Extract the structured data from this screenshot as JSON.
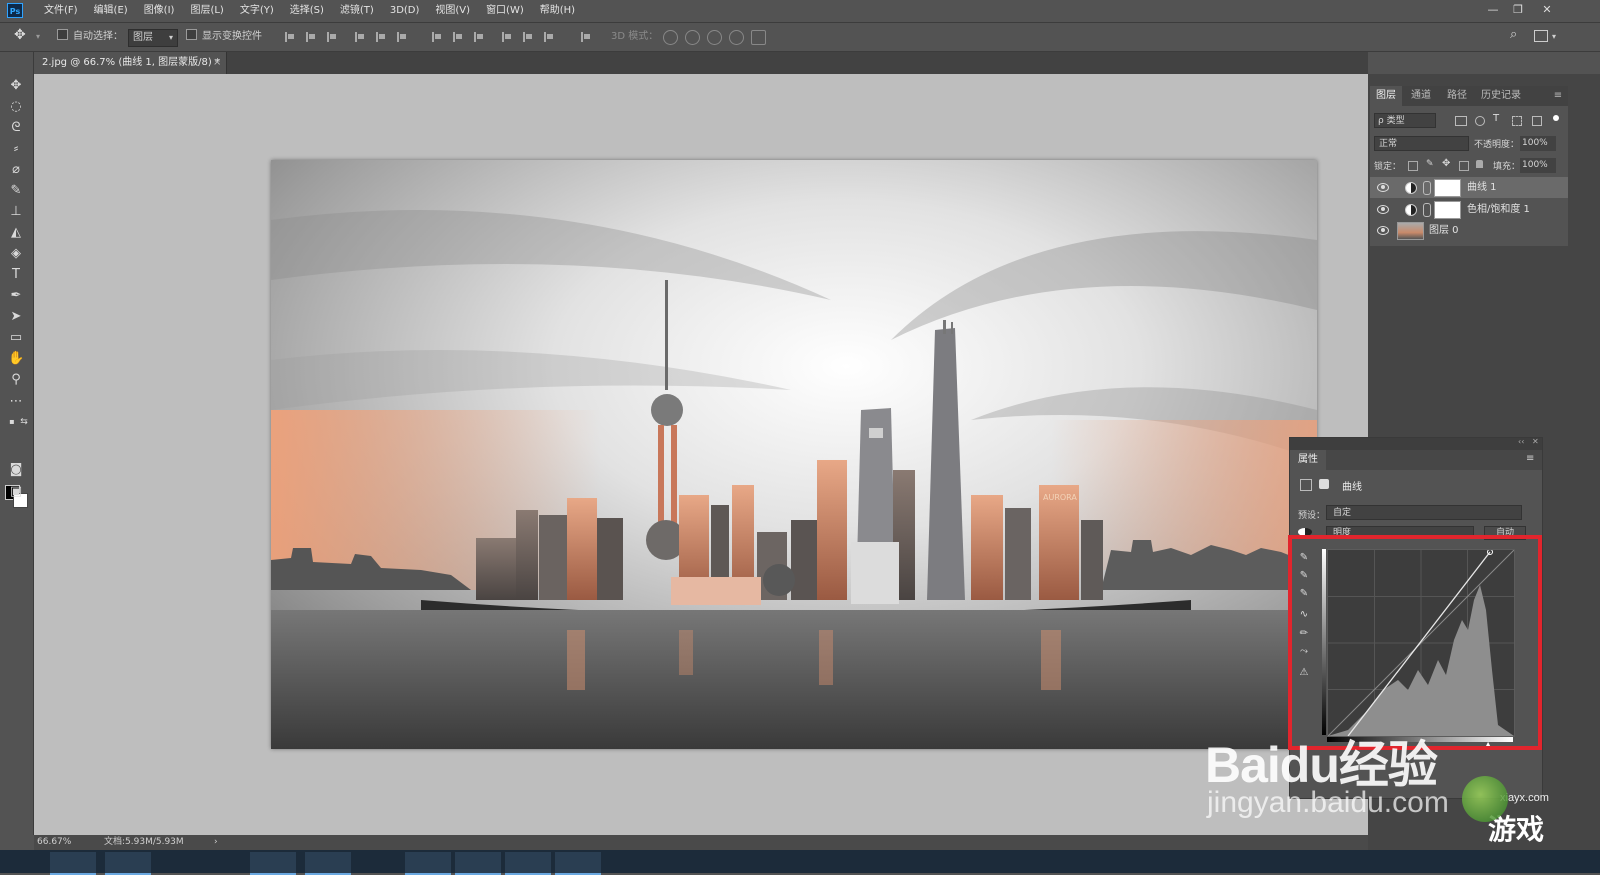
{
  "app": {
    "logo": "Ps",
    "menu": [
      "文件(F)",
      "编辑(E)",
      "图像(I)",
      "图层(L)",
      "文字(Y)",
      "选择(S)",
      "滤镜(T)",
      "3D(D)",
      "视图(V)",
      "窗口(W)",
      "帮助(H)"
    ],
    "window_controls": [
      "—",
      "❐",
      "✕"
    ]
  },
  "options_bar": {
    "move_icon": "move-icon",
    "auto_select_label": "自动选择：",
    "auto_select_value": "图层",
    "show_transform_label": "显示变换控件",
    "mode_3d_label": "3D 模式："
  },
  "document": {
    "tab_title": "2.jpg @ 66.7% (曲线 1, 图层蒙版/8) *",
    "close": "×"
  },
  "status": {
    "zoom": "66.67%",
    "doc_size": "文档:5.93M/5.93M",
    "arrow": "›"
  },
  "layers_panel": {
    "tabs": [
      "图层",
      "通道",
      "路径",
      "历史记录"
    ],
    "filter_label": "ρ 类型",
    "blend_mode": "正常",
    "opacity_label": "不透明度：",
    "opacity_value": "100%",
    "lock_label": "锁定：",
    "fill_label": "填充：",
    "fill_value": "100%",
    "layers": [
      {
        "name": "曲线 1",
        "selected": true
      },
      {
        "name": "色相/饱和度 1",
        "selected": false
      },
      {
        "name": "图层 0",
        "selected": false
      }
    ]
  },
  "properties_panel": {
    "tab": "属性",
    "adjustment_name": "曲线",
    "preset_label": "预设：",
    "preset_value": "自定",
    "channel_value": "明度",
    "auto_button": "自动"
  },
  "watermark": {
    "brand": "Baidu经验",
    "url": "jingyan.baidu.com",
    "game_site": "游戏",
    "site_small": "xiayx.com"
  },
  "colors": {
    "highlight_border": "#e1252d",
    "panel_bg": "#535353",
    "canvas_bg": "#bebebe"
  }
}
